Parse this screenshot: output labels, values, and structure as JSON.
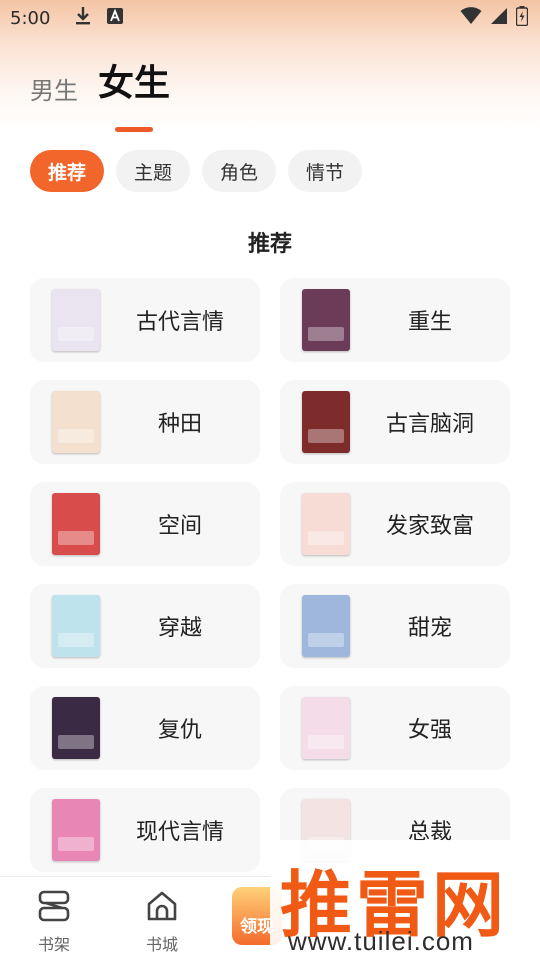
{
  "status_bar": {
    "time": "5:00"
  },
  "gender_tabs": [
    {
      "label": "男生",
      "active": false
    },
    {
      "label": "女生",
      "active": true
    }
  ],
  "chips": [
    {
      "label": "推荐",
      "active": true
    },
    {
      "label": "主题",
      "active": false
    },
    {
      "label": "角色",
      "active": false
    },
    {
      "label": "情节",
      "active": false
    }
  ],
  "section_title": "推荐",
  "categories": [
    {
      "label": "古代言情",
      "cover_color": "#e9e4ef"
    },
    {
      "label": "重生",
      "cover_color": "#6b3b57"
    },
    {
      "label": "种田",
      "cover_color": "#f3e0cf"
    },
    {
      "label": "古言脑洞",
      "cover_color": "#7d2b2b"
    },
    {
      "label": "空间",
      "cover_color": "#d94c4c"
    },
    {
      "label": "发家致富",
      "cover_color": "#f6dcd5"
    },
    {
      "label": "穿越",
      "cover_color": "#bfe3ec"
    },
    {
      "label": "甜宠",
      "cover_color": "#9fb7dc"
    },
    {
      "label": "复仇",
      "cover_color": "#3a2a44"
    },
    {
      "label": "女强",
      "cover_color": "#f4dde8"
    },
    {
      "label": "现代言情",
      "cover_color": "#e887b5"
    },
    {
      "label": "总裁",
      "cover_color": "#f3e3e3"
    }
  ],
  "bottom_nav": {
    "items": [
      {
        "label": "书架"
      },
      {
        "label": "书城"
      }
    ],
    "promo_label": "领现"
  },
  "watermark": {
    "main": "推雷网",
    "url": "www.tuilei.com"
  },
  "colors": {
    "accent": "#f2662b",
    "chip_bg": "#f2f2f2",
    "card_bg": "#f7f7f7"
  }
}
